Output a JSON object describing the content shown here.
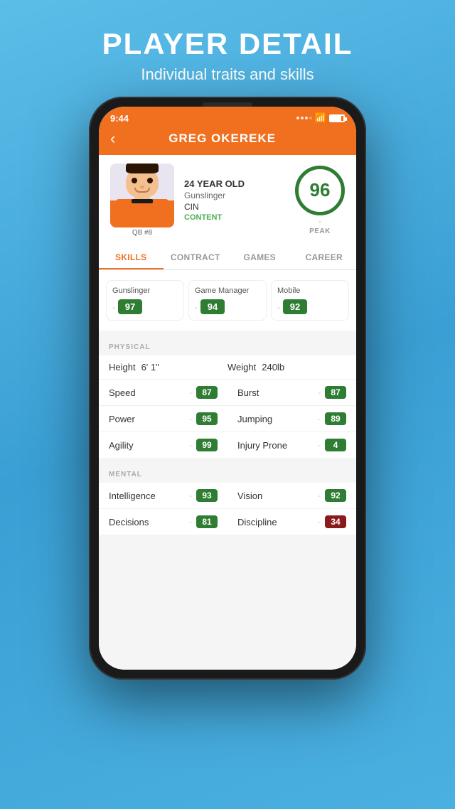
{
  "promo": {
    "title": "PLAYER DETAIL",
    "subtitle": "Individual traits and skills"
  },
  "status_bar": {
    "time": "9:44"
  },
  "nav": {
    "back_label": "‹",
    "player_name": "GREG OKEREKE"
  },
  "player": {
    "age": "24 YEAR OLD",
    "archetype": "Gunslinger",
    "team": "CIN",
    "status": "CONTENT",
    "position": "QB #8",
    "rating": "96",
    "rating_sub": "-",
    "peak_label": "PEAK"
  },
  "tabs": {
    "skills": "SKILLS",
    "contract": "CONTRACT",
    "games": "GAMES",
    "career": "CAREER"
  },
  "skills_top": [
    {
      "name": "Gunslinger",
      "value": "97"
    },
    {
      "name": "Game Manager",
      "value": "94"
    },
    {
      "name": "Mobile",
      "value": "92"
    }
  ],
  "physical": {
    "section_label": "PHYSICAL",
    "height_label": "Height",
    "height_val": "6' 1\"",
    "weight_label": "Weight",
    "weight_val": "240lb",
    "stats": [
      {
        "left_label": "Speed",
        "left_val": "87",
        "left_color": "green",
        "right_label": "Burst",
        "right_val": "87",
        "right_color": "green"
      },
      {
        "left_label": "Power",
        "left_val": "95",
        "left_color": "green",
        "right_label": "Jumping",
        "right_val": "89",
        "right_color": "green"
      },
      {
        "left_label": "Agility",
        "left_val": "99",
        "left_color": "green",
        "right_label": "Injury Prone",
        "right_val": "4",
        "right_color": "green"
      }
    ]
  },
  "mental": {
    "section_label": "MENTAL",
    "stats": [
      {
        "left_label": "Intelligence",
        "left_val": "93",
        "left_color": "green",
        "right_label": "Vision",
        "right_val": "92",
        "right_color": "green"
      },
      {
        "left_label": "Decisions",
        "left_val": "81",
        "left_color": "green",
        "right_label": "Discipline",
        "right_val": "34",
        "right_color": "red"
      }
    ]
  }
}
